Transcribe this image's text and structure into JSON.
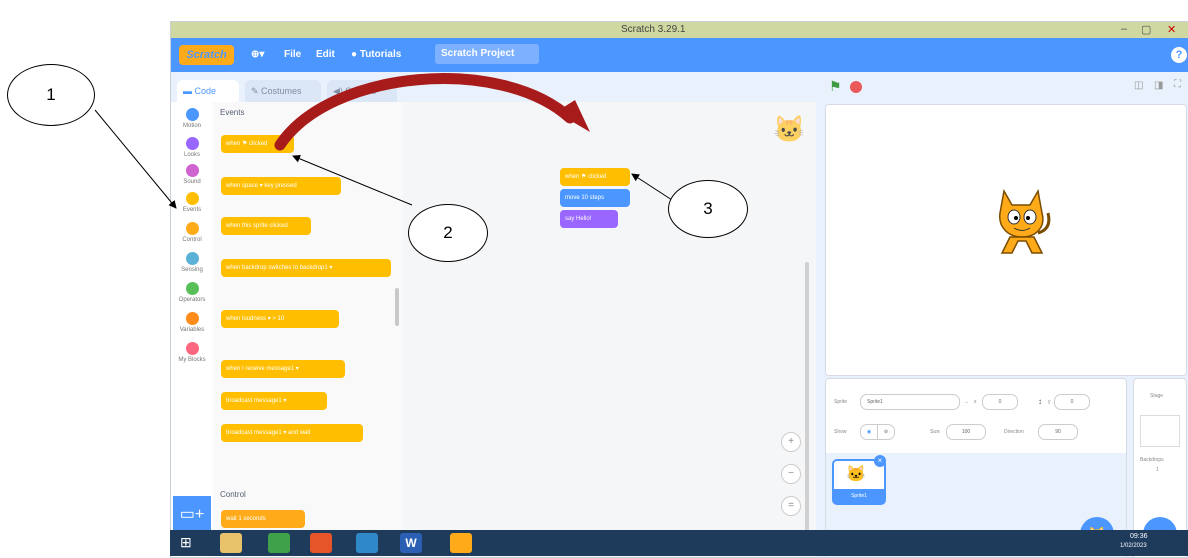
{
  "window": {
    "title": "Scratch 3.29.1",
    "minimize": "–",
    "maximize": "▢",
    "close": "✕"
  },
  "menubar": {
    "logo": "Scratch",
    "language_icon": "globe-icon",
    "file": "File",
    "edit": "Edit",
    "tutorials": "Tutorials",
    "project_name": "Scratch Project"
  },
  "tabs": {
    "code": "Code",
    "costumes": "Costumes",
    "sounds": "Sounds"
  },
  "categories": [
    {
      "label": "Motion",
      "color": "#4c97ff"
    },
    {
      "label": "Looks",
      "color": "#9966ff"
    },
    {
      "label": "Sound",
      "color": "#cf63cf"
    },
    {
      "label": "Events",
      "color": "#ffbf00"
    },
    {
      "label": "Control",
      "color": "#ffab19"
    },
    {
      "label": "Sensing",
      "color": "#5cb1d6"
    },
    {
      "label": "Operators",
      "color": "#59c059"
    },
    {
      "label": "Variables",
      "color": "#ff8c1a"
    },
    {
      "label": "My Blocks",
      "color": "#ff6680"
    }
  ],
  "palette": {
    "events_heading": "Events",
    "control_heading": "Control",
    "blocks": [
      "when ⚑ clicked",
      "when space ▾ key pressed",
      "when this sprite clicked",
      "when backdrop switches to backdrop1 ▾",
      "when loudness ▾ > 10",
      "when I receive message1 ▾",
      "broadcast message1 ▾",
      "broadcast message1 ▾ and wait",
      "wait 1 seconds"
    ]
  },
  "script": {
    "blocks": [
      "when ⚑ clicked",
      "move 10 steps",
      "say Hello!"
    ]
  },
  "zoom": {
    "zoom_in": "+",
    "zoom_out": "−",
    "reset": "="
  },
  "sprite_info": {
    "sprite_label": "Sprite",
    "sprite_name": "Sprite1",
    "x_label": "x",
    "x_value": "0",
    "y_label": "y",
    "y_value": "0",
    "show_label": "Show",
    "size_label": "Size",
    "size_value": "100",
    "direction_label": "Direction",
    "direction_value": "90",
    "thumb_label": "Sprite1"
  },
  "stage_panel": {
    "title": "Stage",
    "backdrops_label": "Backdrops",
    "backdrops_count": "1"
  },
  "callouts": [
    "1",
    "2",
    "3"
  ],
  "taskbar": {
    "clock": "09:36",
    "date": "1/02/2023"
  },
  "colors": {
    "menubar": "#4c97ff",
    "events": "#ffbf00",
    "arrow": "#a81b1b"
  }
}
